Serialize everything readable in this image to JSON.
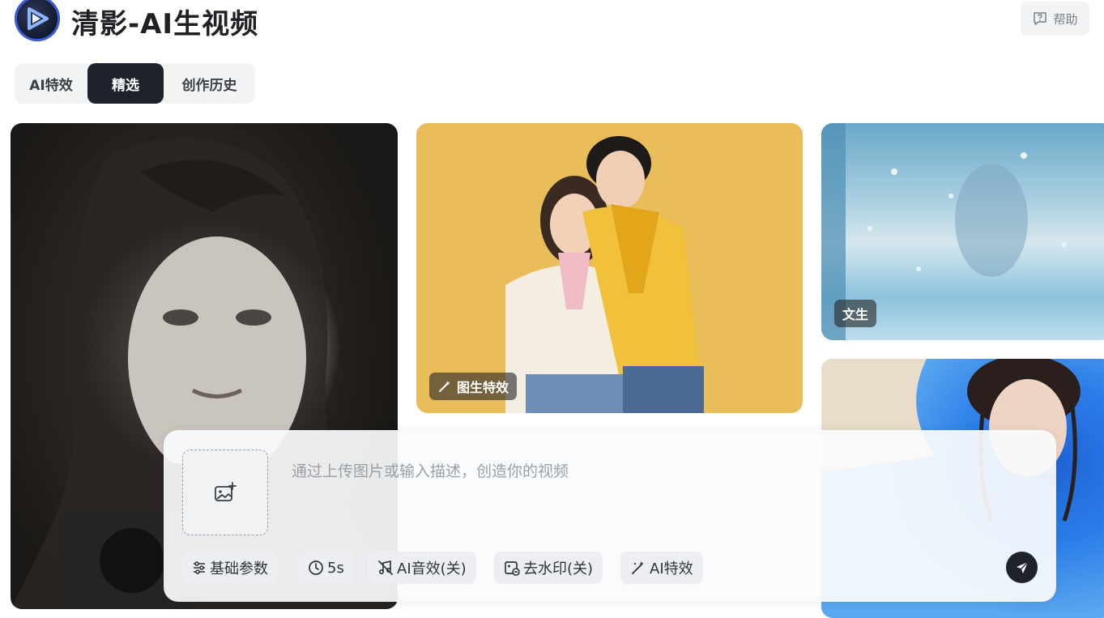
{
  "app": {
    "title": "清影-AI生视频",
    "help_label": "帮助"
  },
  "tabs": [
    {
      "label": "AI特效",
      "active": false
    },
    {
      "label": "精选",
      "active": true
    },
    {
      "label": "创作历史",
      "active": false
    }
  ],
  "cards": [
    {
      "id": "portrait",
      "tag": ""
    },
    {
      "id": "couple",
      "tag": "图生特效"
    },
    {
      "id": "rain",
      "tag": "文生"
    },
    {
      "id": "blue",
      "tag": ""
    }
  ],
  "composer": {
    "placeholder": "通过上传图片或输入描述，创造你的视频",
    "chips": [
      {
        "label": "基础参数",
        "icon": "sliders-icon"
      },
      {
        "label": "5s",
        "icon": "clock-icon"
      },
      {
        "label": "AI音效(关)",
        "icon": "music-off-icon"
      },
      {
        "label": "去水印(关)",
        "icon": "watermark-icon"
      },
      {
        "label": "AI特效",
        "icon": "magic-wand-icon"
      }
    ]
  },
  "colors": {
    "active_tab": "#1d222b",
    "chip_bg": "#eceef1",
    "card_yellow": "#e9bd5a"
  }
}
